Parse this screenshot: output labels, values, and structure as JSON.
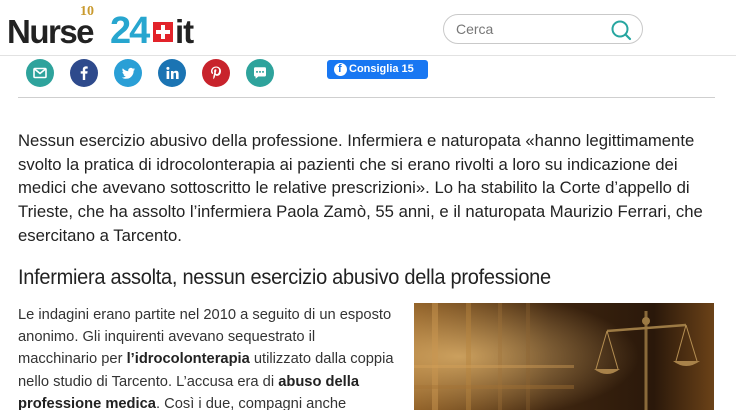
{
  "header": {
    "logo": {
      "word": "Nurse",
      "anniversary": "10",
      "number": "24",
      "tld": "it",
      "brand_blue": "#27a6cf",
      "brand_red": "#e2232a"
    },
    "search": {
      "placeholder": "Cerca",
      "icon": "search-icon"
    }
  },
  "share": {
    "buttons": [
      {
        "icon": "email-icon",
        "color": "#2ea39c"
      },
      {
        "icon": "facebook-icon",
        "color": "#2e4a8c"
      },
      {
        "icon": "twitter-icon",
        "color": "#2a9fd6"
      },
      {
        "icon": "linkedin-icon",
        "color": "#1b74b3"
      },
      {
        "icon": "pinterest-icon",
        "color": "#c8232c"
      },
      {
        "icon": "sms-icon",
        "color": "#2ea39c"
      }
    ],
    "facebook_recommend": {
      "label": "Consiglia 15",
      "color": "#1877f2"
    }
  },
  "article": {
    "intro": "Nessun esercizio abusivo della professione. Infermiera e naturopata «hanno legittimamente svolto la pratica di idrocolonterapia ai pazienti che si erano rivolti a loro su indicazione dei medici che avevano sottoscritto le relative prescrizioni». Lo ha stabilito la Corte d’appello di Trieste, che ha assolto l’infermiera Paola Zamò, 55 anni, e il naturopata Maurizio Ferrari, che esercitano a Tarcento.",
    "subheading": "Infermiera assolta, nessun esercizio abusivo della professione",
    "body": {
      "p1": "Le indagini erano partite nel 2010 a seguito di un esposto anonimo. Gli inquirenti avevano sequestrato il macchinario per ",
      "b1": "l’idrocolonterapia",
      "p2": " utilizzato dalla coppia nello studio di Tarcento. L’accusa era di ",
      "b2": "abuso della professione medica",
      "p3": ". Così i due, compagni anche"
    },
    "image": {
      "subject": "scales-of-justice-photo"
    }
  }
}
